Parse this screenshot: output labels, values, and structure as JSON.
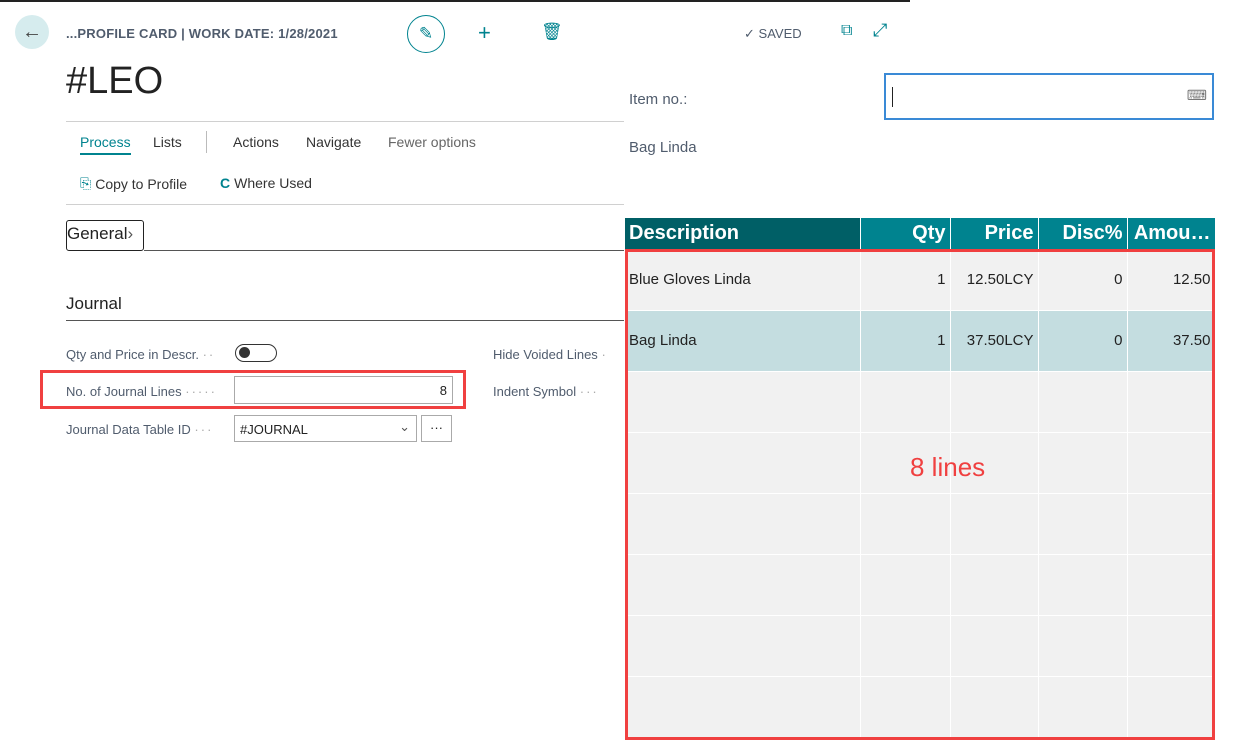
{
  "header": {
    "breadcrumb": "...PROFILE CARD | WORK DATE: 1/28/2021",
    "status": "SAVED",
    "title": "#LEO"
  },
  "tabs": [
    {
      "label": "Process"
    },
    {
      "label": "Lists"
    },
    {
      "label": "Actions"
    },
    {
      "label": "Navigate"
    },
    {
      "label": "Fewer options"
    }
  ],
  "actions": {
    "copy": "Copy to Profile",
    "where_used": "Where Used"
  },
  "sections": {
    "general": "General",
    "journal": "Journal"
  },
  "fields": {
    "qty_price_label": "Qty and Price in Descr.",
    "qty_price_on": false,
    "lines_label": "No. of Journal Lines",
    "lines_value": "8",
    "table_label": "Journal Data Table ID",
    "table_value": "#JOURNAL",
    "hide_voided_label": "Hide Voided Lines",
    "indent_label": "Indent Symbol"
  },
  "preview": {
    "item_label": "Item no.:",
    "item_value": "",
    "item_name": "Bag Linda",
    "columns": [
      "Description",
      "Qty",
      "Price",
      "Disc%",
      "Amou…"
    ],
    "rows": [
      [
        "Blue Gloves Linda",
        "1",
        "12.50LCY",
        "0",
        "12.50"
      ],
      [
        "Bag Linda",
        "1",
        "37.50LCY",
        "0",
        "37.50"
      ]
    ],
    "annotation": "8 lines"
  },
  "colors": {
    "accent": "#00838f",
    "header_dark": "#005f66",
    "highlight": "#f04040"
  }
}
